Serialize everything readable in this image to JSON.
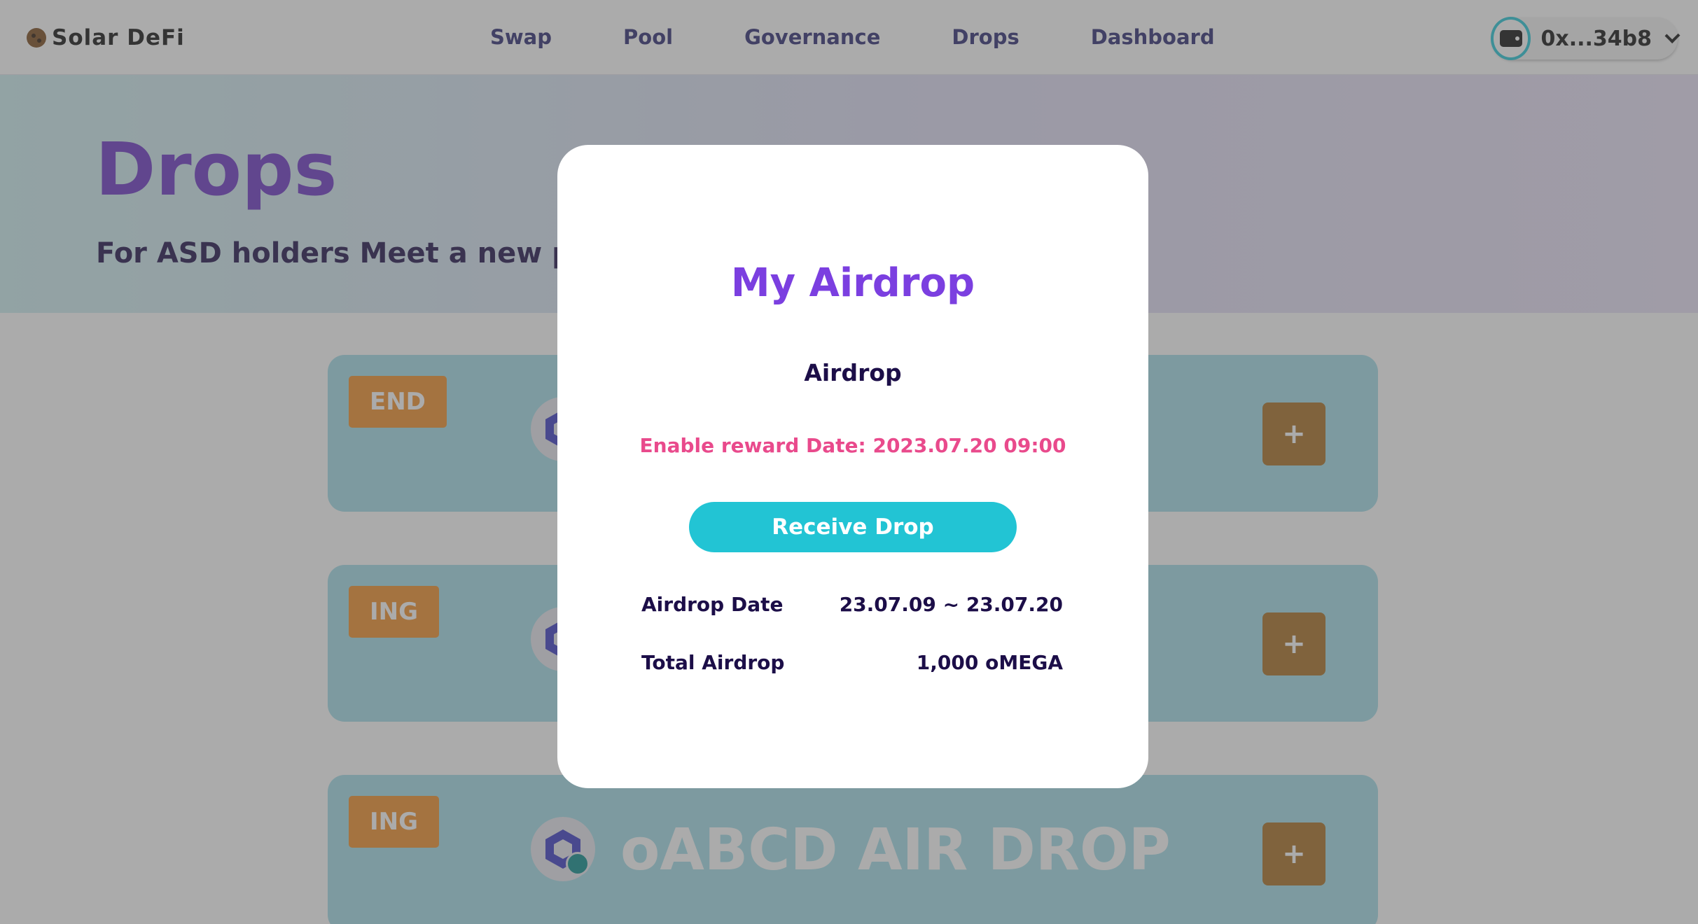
{
  "header": {
    "logo": "Solar DeFi",
    "nav": [
      "Swap",
      "Pool",
      "Governance",
      "Drops",
      "Dashboard"
    ],
    "wallet_address": "0x...34b8"
  },
  "hero": {
    "title": "Drops",
    "subtitle": "For ASD holders Meet a new proj"
  },
  "cards": [
    {
      "status": "END",
      "title": ""
    },
    {
      "status": "ING",
      "title": ""
    },
    {
      "status": "ING",
      "title": "oABCD AIR DROP"
    }
  ],
  "card_plus": "+",
  "modal": {
    "title": "My Airdrop",
    "subtitle": "Airdrop",
    "reward_date": "Enable reward Date: 2023.07.20 09:00",
    "button": "Receive Drop",
    "rows": [
      {
        "label": "Airdrop Date",
        "value": "23.07.09 ~ 23.07.20"
      },
      {
        "label": "Total Airdrop",
        "value": "1,000 oMEGA"
      }
    ]
  },
  "colors": {
    "accent_purple": "#7b3fe0",
    "accent_cyan": "#22c4d4",
    "accent_pink": "#e94a8c",
    "badge_orange": "#f08f28"
  }
}
